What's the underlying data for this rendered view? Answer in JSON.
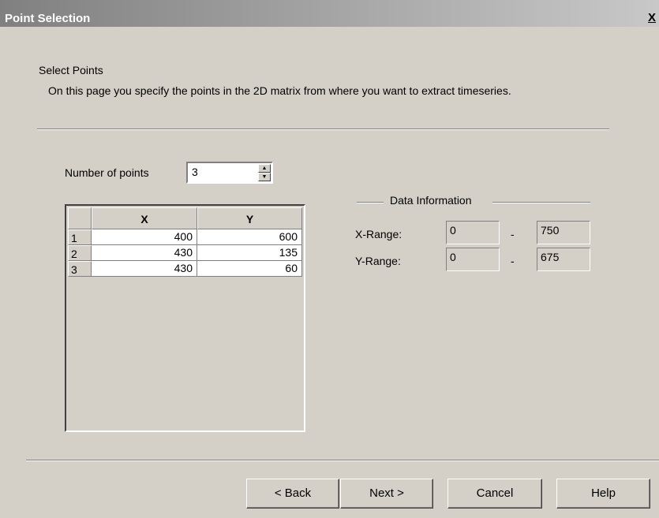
{
  "window": {
    "title": "Point Selection",
    "close_label": "X"
  },
  "page": {
    "heading": "Select Points",
    "description": "On this page you specify the points in the 2D matrix from where you want to extract timeseries."
  },
  "points": {
    "count_label": "Number of points",
    "count_value": "3",
    "columns": [
      "X",
      "Y"
    ],
    "rows": [
      {
        "index": "1",
        "x": "400",
        "y": "600"
      },
      {
        "index": "2",
        "x": "430",
        "y": "135"
      },
      {
        "index": "3",
        "x": "430",
        "y": "60"
      }
    ]
  },
  "data_info": {
    "title": "Data Information",
    "x_label": "X-Range:",
    "x_min": "0",
    "x_max": "750",
    "y_label": "Y-Range:",
    "y_min": "0",
    "y_max": "675",
    "dash": "-"
  },
  "buttons": {
    "back": "< Back",
    "next": "Next >",
    "cancel": "Cancel",
    "help": "Help"
  },
  "colors": {
    "face": "#d4d0c8",
    "title_gradient_start": "#808080"
  }
}
